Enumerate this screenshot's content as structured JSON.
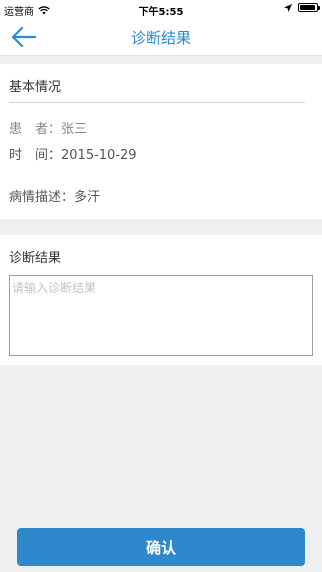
{
  "status_bar": {
    "carrier": "运营商",
    "time": "下午5:55"
  },
  "nav": {
    "title": "诊断结果",
    "back_icon": "arrow-left-icon"
  },
  "basic_info": {
    "title": "基本情况",
    "patient_label": "患　者：",
    "patient_value": "张三",
    "time_label": "时　间：",
    "time_value": "2015-10-29",
    "desc_label": "病情描述：",
    "desc_value": "多汗"
  },
  "diagnosis": {
    "title": "诊断结果",
    "placeholder": "请输入诊断结果",
    "value": ""
  },
  "actions": {
    "confirm_label": "确认"
  },
  "colors": {
    "accent": "#2a8bd0",
    "button": "#2d88cc",
    "background": "#efefef"
  }
}
